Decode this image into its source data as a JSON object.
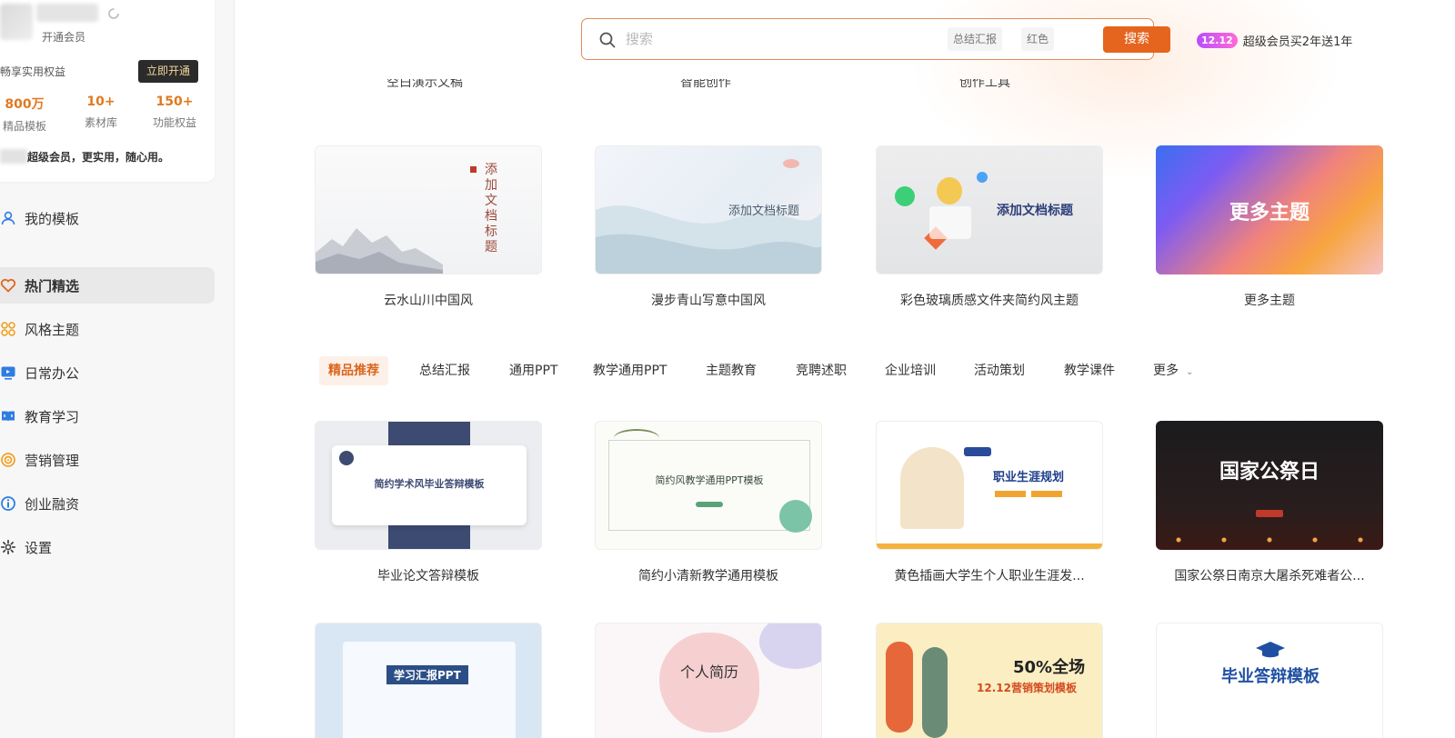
{
  "sidebar": {
    "vip": {
      "open_vip_link": "开通会员",
      "rights_title": "畅享实用权益",
      "open_now_button": "立即开通",
      "stats": [
        {
          "value": "800万",
          "label": "精品模板"
        },
        {
          "value": "10+",
          "label": "素材库"
        },
        {
          "value": "150+",
          "label": "功能权益"
        }
      ],
      "slogan": "超级会员，更实用，随心用。"
    },
    "nav": [
      {
        "label": "我的模板",
        "icon": "user-icon"
      },
      {
        "label": "热门精选",
        "icon": "heart-icon",
        "active": true
      },
      {
        "label": "风格主题",
        "icon": "grid-icon"
      },
      {
        "label": "日常办公",
        "icon": "monitor-icon"
      },
      {
        "label": "教育学习",
        "icon": "book-icon"
      },
      {
        "label": "营销管理",
        "icon": "target-icon"
      },
      {
        "label": "创业融资",
        "icon": "info-icon"
      },
      {
        "label": "设置",
        "icon": "gear-icon"
      }
    ]
  },
  "search": {
    "placeholder": "搜索",
    "tags": [
      "总结汇报",
      "红色"
    ],
    "button": "搜索"
  },
  "promo": {
    "badge": "12.12",
    "text": "超级会员买2年送1年"
  },
  "cut_labels": [
    "空白演示文稿",
    "智能创作",
    "创作工具"
  ],
  "themes": [
    {
      "title": "云水山川中国风",
      "thumb_text": "添加文档标题"
    },
    {
      "title": "漫步青山写意中国风",
      "thumb_text": "添加文档标题"
    },
    {
      "title": "彩色玻璃质感文件夹简约风主题",
      "thumb_text": "添加文档标题"
    },
    {
      "title": "更多主题",
      "thumb_text": "更多主题"
    }
  ],
  "categories": [
    "精品推荐",
    "总结汇报",
    "通用PPT",
    "教学通用PPT",
    "主题教育",
    "竞聘述职",
    "企业培训",
    "活动策划",
    "教学课件",
    "更多"
  ],
  "templates_row1": [
    {
      "title": "毕业论文答辩模板",
      "thumb_text": "简约学术风毕业答辩模板"
    },
    {
      "title": "简约小清新教学通用模板",
      "thumb_text": "简约风教学通用PPT模板"
    },
    {
      "title": "黄色插画大学生个人职业生涯发...",
      "thumb_text": "职业生涯规划"
    },
    {
      "title": "国家公祭日南京大屠杀死难者公...",
      "thumb_text": "国家公祭日"
    }
  ],
  "templates_row2": [
    {
      "thumb_text": "学习汇报PPT"
    },
    {
      "thumb_text": "个人简历"
    },
    {
      "thumb_text": "12.12营销策划模板",
      "thumb_sub": "50%全场"
    },
    {
      "thumb_text": "毕业答辩模板"
    }
  ],
  "colors": {
    "accent": "#e5651e",
    "active_tab_bg": "#fdf0e8",
    "vip_gold": "#e07a20"
  }
}
